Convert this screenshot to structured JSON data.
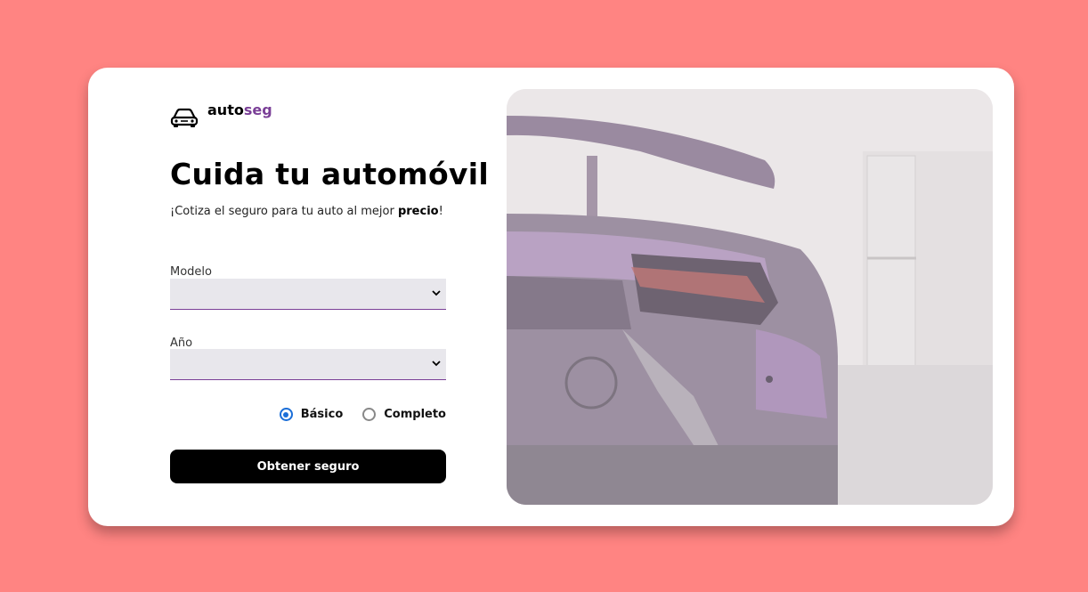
{
  "logo": {
    "icon": "car-icon",
    "prefix": "auto",
    "accent": "seg",
    "accent_color": "#7a3f97"
  },
  "hero": {
    "title": "Cuida tu automóvil",
    "subtitle_before": "¡Cotiza el seguro para tu auto al mejor ",
    "subtitle_bold": "precio",
    "subtitle_after": "!"
  },
  "form": {
    "model": {
      "label": "Modelo",
      "value": "",
      "icon": "chevron-down-icon"
    },
    "year": {
      "label": "Año",
      "value": "",
      "icon": "chevron-down-icon"
    },
    "plan": {
      "options": [
        {
          "label": "Básico",
          "selected": true
        },
        {
          "label": "Completo",
          "selected": false
        }
      ]
    },
    "submit_label": "Obtener seguro"
  },
  "colors": {
    "background": "#ff8482",
    "accent": "#7a3f97",
    "radio": "#1a6ed8",
    "button": "#000000"
  }
}
